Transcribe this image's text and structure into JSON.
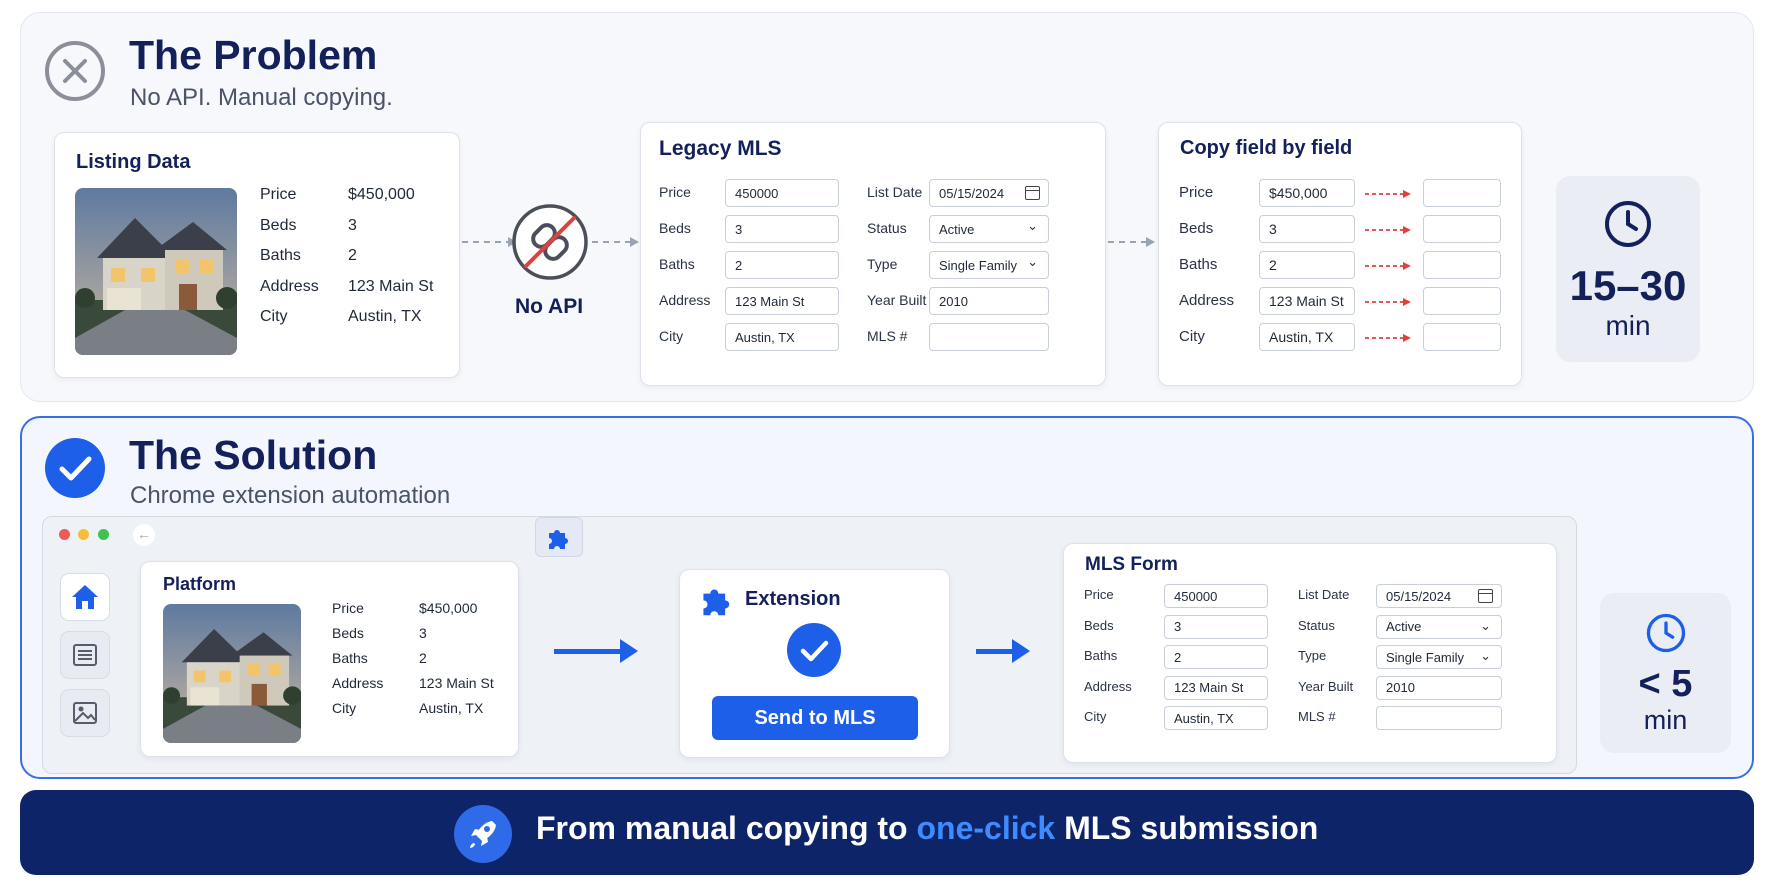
{
  "problem": {
    "title": "The Problem",
    "subtitle": "No API. Manual copying.",
    "listing_card": {
      "title": "Listing Data",
      "rows": [
        {
          "label": "Price",
          "value": "$450,000"
        },
        {
          "label": "Beds",
          "value": "3"
        },
        {
          "label": "Baths",
          "value": "2"
        },
        {
          "label": "Address",
          "value": "123 Main St"
        },
        {
          "label": "City",
          "value": "Austin, TX"
        }
      ]
    },
    "no_api_label": "No API",
    "legacy_mls": {
      "title": "Legacy MLS",
      "left_fields": [
        {
          "label": "Price",
          "value": "450000"
        },
        {
          "label": "Beds",
          "value": "3"
        },
        {
          "label": "Baths",
          "value": "2"
        },
        {
          "label": "Address",
          "value": "123 Main St"
        },
        {
          "label": "City",
          "value": "Austin, TX"
        }
      ],
      "right_fields": [
        {
          "label": "List Date",
          "value": "05/15/2024"
        },
        {
          "label": "Status",
          "value": "Active"
        },
        {
          "label": "Type",
          "value": "Single Family"
        },
        {
          "label": "Year Built",
          "value": "2010"
        },
        {
          "label": "MLS #",
          "value": ""
        }
      ]
    },
    "copy_card": {
      "title": "Copy field by field",
      "rows": [
        {
          "label": "Price",
          "value": "$450,000"
        },
        {
          "label": "Beds",
          "value": "3"
        },
        {
          "label": "Baths",
          "value": "2"
        },
        {
          "label": "Address",
          "value": "123 Main St"
        },
        {
          "label": "City",
          "value": "Austin, TX"
        }
      ]
    },
    "time": {
      "value": "15–30",
      "unit": "min"
    }
  },
  "solution": {
    "title": "The Solution",
    "subtitle": "Chrome extension automation",
    "platform_card": {
      "title": "Platform",
      "rows": [
        {
          "label": "Price",
          "value": "$450,000"
        },
        {
          "label": "Beds",
          "value": "3"
        },
        {
          "label": "Baths",
          "value": "2"
        },
        {
          "label": "Address",
          "value": "123 Main St"
        },
        {
          "label": "City",
          "value": "Austin, TX"
        }
      ]
    },
    "extension_card": {
      "title": "Extension",
      "button_label": "Send to MLS"
    },
    "mls_form": {
      "title": "MLS Form",
      "left_fields": [
        {
          "label": "Price",
          "value": "450000"
        },
        {
          "label": "Beds",
          "value": "3"
        },
        {
          "label": "Baths",
          "value": "2"
        },
        {
          "label": "Address",
          "value": "123 Main St"
        },
        {
          "label": "City",
          "value": "Austin, TX"
        }
      ],
      "right_fields": [
        {
          "label": "List Date",
          "value": "05/15/2024"
        },
        {
          "label": "Status",
          "value": "Active"
        },
        {
          "label": "Type",
          "value": "Single Family"
        },
        {
          "label": "Year Built",
          "value": "2010"
        },
        {
          "label": "MLS #",
          "value": ""
        }
      ]
    },
    "time": {
      "value": "< 5",
      "unit": "min"
    }
  },
  "banner": {
    "text_before": "From manual copying to ",
    "highlight": "one-click",
    "text_after": " MLS submission"
  },
  "colors": {
    "navy": "#13205a",
    "accent_blue": "#1d5fe8",
    "banner_bg": "#0e2468",
    "highlight_blue": "#3d8bff",
    "error_red": "#e0413f",
    "problem_icon_gray": "#8a8f99"
  }
}
